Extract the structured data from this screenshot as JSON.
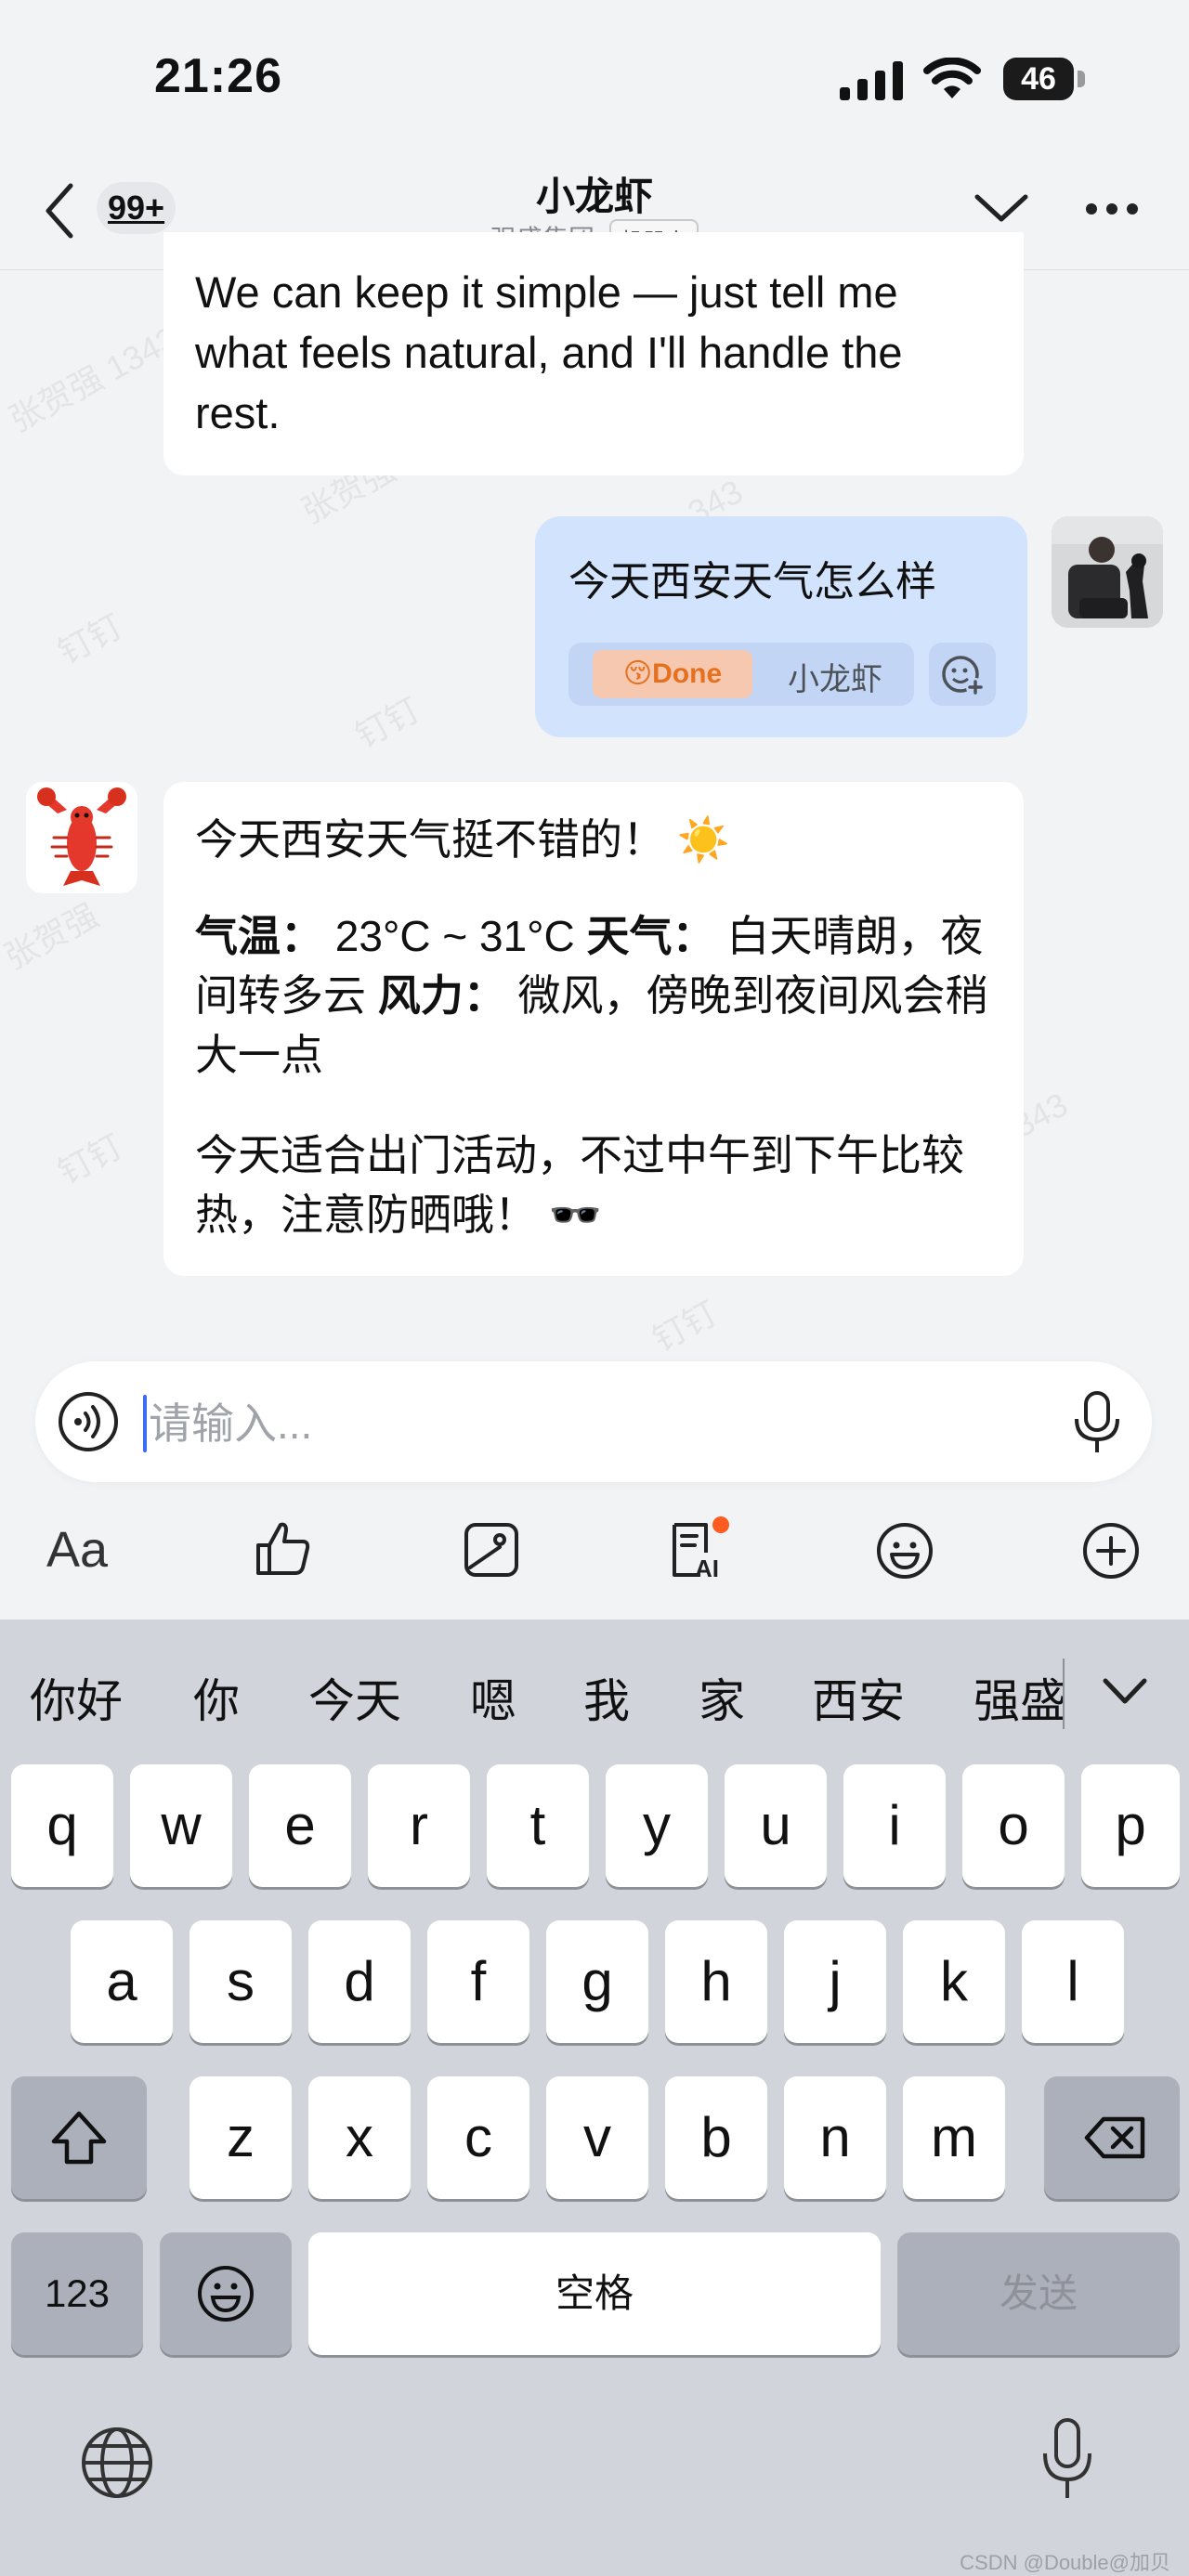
{
  "status_bar": {
    "time": "21:26",
    "battery": "46"
  },
  "header": {
    "back_count": "99+",
    "title": "小龙虾",
    "subtitle": "强盛集团",
    "bot_tag": "机器人"
  },
  "watermark": {
    "name": "张贺强 1343",
    "name2": "张贺强",
    "app": "钉钉",
    "num": "343"
  },
  "messages": {
    "prev_bot_text": "We can keep it simple — just tell me what feels natural, and I'll handle the rest.",
    "user_text": "今天西安天气怎么样",
    "done_label": "Done",
    "done_emoji": "😚",
    "done_sender": "小龙虾",
    "reply_line1": "今天西安天气挺不错的！ ☀️",
    "reply_temp_label": "气温：",
    "reply_temp_value": " 23°C ~ 31°C ",
    "reply_weather_label": "天气：",
    "reply_weather_value": " 白天晴朗，夜间转多云 ",
    "reply_wind_label": "风力：",
    "reply_wind_value": " 微风，傍晚到夜间风会稍大一点",
    "reply_tip": "今天适合出门活动，不过中午到下午比较热，注意防晒哦！ 🕶️"
  },
  "input": {
    "placeholder": "请输入..."
  },
  "toolbar": {
    "font_label": "Aa"
  },
  "keyboard": {
    "suggestions": [
      "你好",
      "你",
      "今天",
      "嗯",
      "我",
      "家",
      "西安",
      "强盛"
    ],
    "row1": [
      "q",
      "w",
      "e",
      "r",
      "t",
      "y",
      "u",
      "i",
      "o",
      "p"
    ],
    "row2": [
      "a",
      "s",
      "d",
      "f",
      "g",
      "h",
      "j",
      "k",
      "l"
    ],
    "row3": [
      "z",
      "x",
      "c",
      "v",
      "b",
      "n",
      "m"
    ],
    "num_label": "123",
    "space_label": "空格",
    "send_label": "发送"
  },
  "footer": {
    "source": "CSDN @Double@加贝"
  },
  "colors": {
    "accent": "#3a6df0",
    "user_bubble": "#d2e3fd",
    "badge_dot": "#ff5a1f"
  }
}
